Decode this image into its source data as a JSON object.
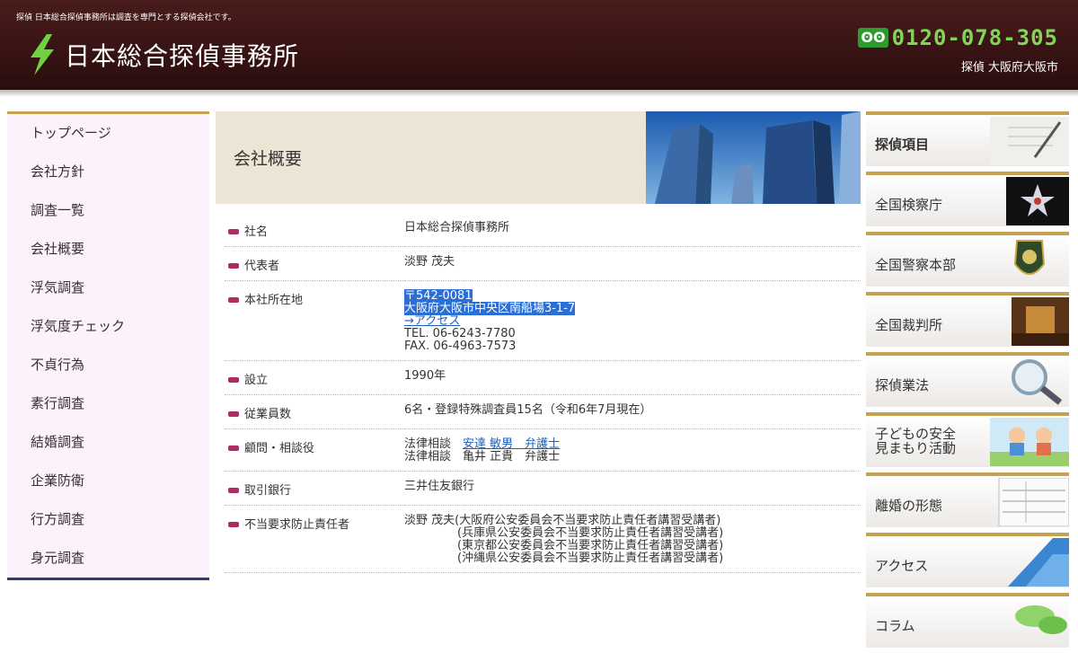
{
  "header": {
    "tagline": "探偵 日本総合探偵事務所は調査を専門とする探偵会社です。",
    "logo": "日本総合探偵事務所",
    "freedial": "ʘʘ",
    "phone": "0120-078-305",
    "location": "探偵 大阪府大阪市"
  },
  "left_nav": [
    "トップページ",
    "会社方針",
    "調査一覧",
    "会社概要",
    "浮気調査",
    "浮気度チェック",
    "不貞行為",
    "素行調査",
    "結婚調査",
    "企業防衛",
    "行方調査",
    "身元調査"
  ],
  "main": {
    "title": "会社概要",
    "rows": [
      {
        "label": "社名",
        "lines": [
          "日本総合探偵事務所"
        ]
      },
      {
        "label": "代表者",
        "lines": [
          "淡野 茂夫"
        ]
      },
      {
        "label": "本社所在地",
        "lines": [
          "〒542-0081",
          "大阪府大阪市中央区南船場3-1-7",
          "→アクセス",
          "TEL. 06-6243-7780",
          "FAX. 06-4963-7573"
        ]
      },
      {
        "label": "設立",
        "lines": [
          "1990年"
        ]
      },
      {
        "label": "従業員数",
        "lines": [
          "6名・登録特殊調査員15名（令和6年7月現在）"
        ]
      },
      {
        "label": "顧問・相談役",
        "lines": [
          "法律相談　",
          "安達 敏男　弁護士",
          "法律相談　亀井 正貴　弁護士"
        ]
      },
      {
        "label": "取引銀行",
        "lines": [
          "三井住友銀行"
        ]
      },
      {
        "label": "不当要求防止責任者",
        "lines": [
          "淡野 茂夫(大阪府公安委員会不当要求防止責任者講習受講者)",
          "(兵庫県公安委員会不当要求防止責任者講習受講者)",
          "(東京都公安委員会不当要求防止責任者講習受講者)",
          "(沖縄県公安委員会不当要求防止責任者講習受講者)"
        ]
      }
    ]
  },
  "right_nav": [
    "探偵項目",
    "全国検察庁",
    "全国警察本部",
    "全国裁判所",
    "探偵業法",
    "子どもの安全",
    "見まもり活動",
    "離婚の形態",
    "アクセス",
    "コラム"
  ],
  "colors": {
    "header": "#3a1414",
    "accent": "#c7a152",
    "nav_border": "#2c3c7a",
    "phone": "#7fd657",
    "marker": "#b22a62"
  }
}
